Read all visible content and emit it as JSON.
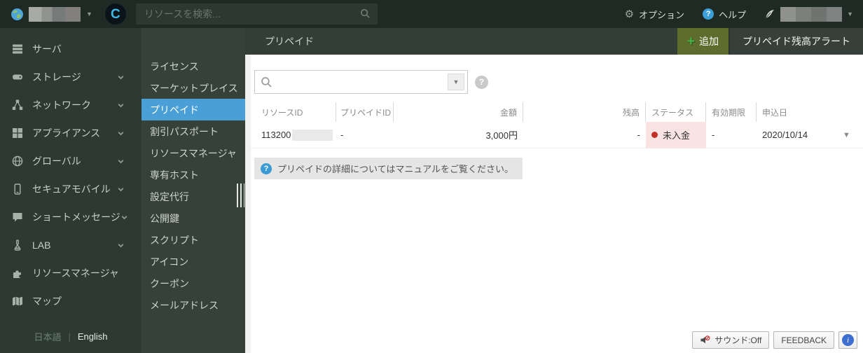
{
  "topbar": {
    "search_placeholder": "リソースを検索...",
    "options_label": "オプション",
    "help_label": "ヘルプ"
  },
  "sidebar": {
    "items": [
      {
        "label": "サーバ",
        "icon": "server-icon",
        "has_chevron": false
      },
      {
        "label": "ストレージ",
        "icon": "storage-icon",
        "has_chevron": true
      },
      {
        "label": "ネットワーク",
        "icon": "network-icon",
        "has_chevron": true
      },
      {
        "label": "アプライアンス",
        "icon": "appliance-icon",
        "has_chevron": true
      },
      {
        "label": "グローバル",
        "icon": "globe-icon",
        "has_chevron": true
      },
      {
        "label": "セキュアモバイル",
        "icon": "mobile-icon",
        "has_chevron": true
      },
      {
        "label": "ショートメッセージ",
        "icon": "message-icon",
        "has_chevron": true
      },
      {
        "label": "LAB",
        "icon": "flask-icon",
        "has_chevron": true
      },
      {
        "label": "リソースマネージャ",
        "icon": "puzzle-icon",
        "has_chevron": false
      },
      {
        "label": "マップ",
        "icon": "map-icon",
        "has_chevron": false
      }
    ]
  },
  "language": {
    "ja": "日本語",
    "sep": "|",
    "en": "English"
  },
  "submenu": {
    "selected_index": 2,
    "items": [
      {
        "label": "ライセンス"
      },
      {
        "label": "マーケットプレイス"
      },
      {
        "label": "プリペイド"
      },
      {
        "label": "割引パスポート"
      },
      {
        "label": "リソースマネージャ"
      },
      {
        "label": "専有ホスト"
      },
      {
        "label": "設定代行"
      },
      {
        "label": "公開鍵"
      },
      {
        "label": "スクリプト"
      },
      {
        "label": "アイコン"
      },
      {
        "label": "クーポン"
      },
      {
        "label": "メールアドレス"
      }
    ]
  },
  "page": {
    "title": "プリペイド",
    "add_label": "追加",
    "alert_label": "プリペイド残高アラート"
  },
  "table": {
    "columns": [
      "リソースID",
      "プリペイドID",
      "金額",
      "残高",
      "ステータス",
      "有効期限",
      "申込日"
    ],
    "row": {
      "resource_id": "113200",
      "prepaid_id": "-",
      "amount": "3,000円",
      "balance": "-",
      "status": "未入金",
      "expiry": "-",
      "apply_date": "2020/10/14"
    }
  },
  "info": {
    "message": "プリペイドの詳細についてはマニュアルをご覧ください。"
  },
  "footer": {
    "sound_label": "サウンド:Off",
    "feedback_label": "FEEDBACK"
  },
  "colors": {
    "topbar_bg": "#1f2a24",
    "sidebar_bg": "#2d3a33",
    "submenu_bg": "#364139",
    "selected_blue": "#4a9fd6",
    "header_bg": "#333e37",
    "add_button_bg": "#5e6c2d",
    "add_plus_green": "#47b545",
    "status_pink_bg": "#f9e3e3",
    "status_dot_red": "#c2302a",
    "logo_cyan": "#3fb9e8",
    "help_blue": "#3ba0da"
  }
}
